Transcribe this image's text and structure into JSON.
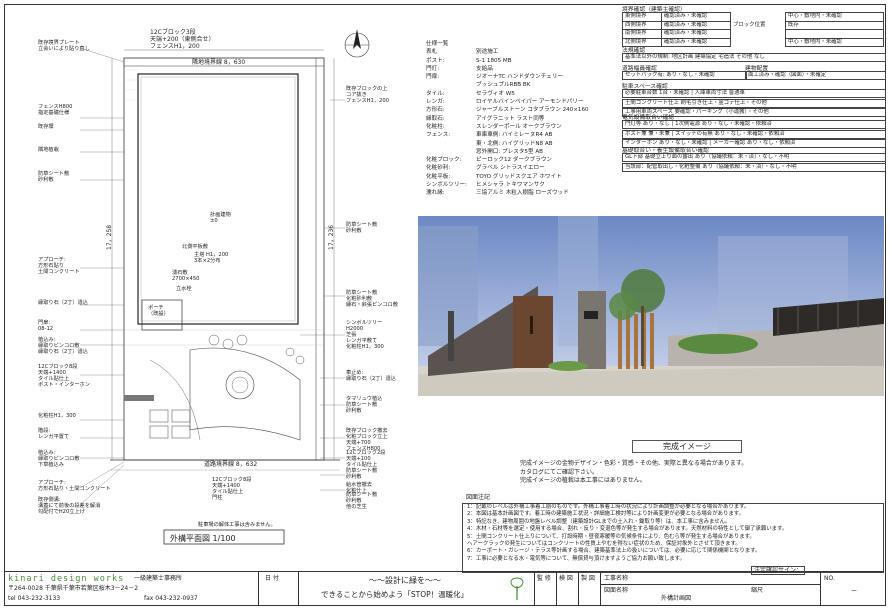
{
  "plan": {
    "top_label": "12Cブロック3段\n天端+200（東側合せ）\nフェンスH1，200",
    "left_labels": [
      "既存境界プレート\n立会いにより貼り直し",
      "フェンスH800\n指定基礎仕様",
      "既存塀",
      "隣地植栽",
      "防草シート敷\n砂利敷",
      "アプローチ:\n方形石貼り\n土間コンクリート",
      "縁取り石（2丁）違込",
      "門扉:\n08-12",
      "植込み:\n縁取りピンコロ敷\n縁取り石（2丁）違込",
      "12Cブロック8段\n天端+1400\nタイル貼仕上\nポスト・インターホン",
      "化粧柱H1，300",
      "階段:\nレンガ平置て",
      "植込み:\n縁取りピンコロ敷\n下草植込み",
      "アプローチ:\n方形石貼り・土間コンクリート",
      "既存側溝:\n溝蓋にて前後の段差を解消\n勾配付でH20立上げ"
    ],
    "right_labels": [
      "既存ブロックの上\nコア抜き\nフェンスH1，200",
      "防草シート敷\n砂利敷",
      "防草シート敷\n化粧砂利敷\n縁石・斜張ピンコロ敷",
      "シンボルツリー\nH2000\n芝張\nレンガ平敷て\n化粧柱H1，300",
      "車止め:\n縁取り石（2丁）違込",
      "タマリュウ植込\n防草シート敷\n砂利敷",
      "既存ブロック撤去\n化粧ブロック立上\n天端+700\nフェンスH800",
      "12Cブロック2段\n天端+100\nタイル貼仕上",
      "防草シート敷\n砂利敷",
      "給水管撤去\n化粧仕上",
      "防草シート敷\n砂利敷\n他の芝生"
    ],
    "center_labels": [
      "計画建物\n±0",
      "北側平板敷",
      "主塔 H1，200\n3本×2分布",
      "湧石敷\n2700×450",
      "立水栓",
      "ポーチ\n（既設）",
      "12Cブロック8段\n天端+1400\nタイル貼仕上\n門柱",
      "駐車場の解体工事は含みません。"
    ],
    "boundary_top": "隣地境界線 8，630",
    "boundary_bottom": "道路境界線 8，632",
    "dim_left": "17，258",
    "dim_right": "17，236",
    "title": "外構平面図 1/100"
  },
  "spec": {
    "header_left": "仕様一覧",
    "header_right": "",
    "rows": [
      {
        "k": "表札",
        "v": "別途施工"
      },
      {
        "k": "ポスト:",
        "v": "S-1 1805 MB"
      },
      {
        "k": "門灯:",
        "v": "支給品"
      },
      {
        "k": "門扉:",
        "v": "ジオーナTC ハンドダウンチェリー"
      },
      {
        "k": "",
        "v": "プッシュプルRBB BK"
      },
      {
        "k": "タイル:",
        "v": "セラヴィオ W5"
      },
      {
        "k": "レンガ:",
        "v": "ロイヤルバインペイパー アーモンドパリー"
      },
      {
        "k": "方形石:",
        "v": "ジャーブルストーン コタブラウン 240×160"
      },
      {
        "k": "縁取石:",
        "v": "アイグラニット ラスト同等"
      },
      {
        "k": "化粧柱:",
        "v": "スレンダーポール オークブラウン"
      },
      {
        "k": "フェンス:",
        "v": "車庫車側: ハイミレーヌR4 AB"
      },
      {
        "k": "",
        "v": "東・北側: ハイグリッドN8 AB"
      },
      {
        "k": "",
        "v": "窓外開口: プレスタ5型 AB"
      },
      {
        "k": "化粧ブロック:",
        "v": "ピーロック12 ダークブラウン"
      },
      {
        "k": "化粧砂利:",
        "v": "グラベル シトラスイエロー"
      },
      {
        "k": "化粧平板:",
        "v": "TOYO グリッドスクエア ホワイト"
      },
      {
        "k": "シンボルツリー:",
        "v": "ヒメシャラ トキワマンサク"
      },
      {
        "k": "濡れ縁:",
        "v": "三協アルミ 木粒入樹脂 ローズウッド"
      }
    ]
  },
  "checks": {
    "boundary_title": "境界確認（建築主確認）",
    "boundary_rows": [
      {
        "side": "東側境界",
        "opt": "確認済み・未確認"
      },
      {
        "side": "西側境界",
        "opt": "確認済み・未確認"
      },
      {
        "side": "南側境界",
        "opt": "確認済み・未確認"
      },
      {
        "side": "北側境界",
        "opt": "確認済み・未確認"
      }
    ],
    "block_label": "ブロック位置",
    "block_opts": [
      "中心・敷地内・未確認",
      "既存",
      "",
      "中心・敷地内・未確認"
    ],
    "law_title": "法規確認",
    "law_row": "基準法以外の規制: 地区計画 建築協定 宅造法 その他 なし",
    "road_title": "道路幅員確認",
    "road_label": "建物配置",
    "road_row1": "セットバック有: あり・なし・未確認",
    "road_row2": "面工済み・確認（図面）・未確定",
    "parking_title": "駐車スペース確認",
    "parking_rows": [
      "必要駐車台数 1台・未確認 | 入庫車両寸法 普通車",
      "土間コンクリート仕上 刷毛引き仕上・金ゴテ仕上・その他",
      "工事用車両スペース 要確認・パーキング（小運搬）・その他"
    ],
    "elec_title": "電気設備取合い確認",
    "elec_rows": [
      "門灯等 あり・なし | 1次側電源 あり・なし・未確認・依頼済",
      "ポスト兼 兼・未兼 | スイッチの有無 あり・なし・未確認・依頼済",
      "インターホン あり・なし・未確認 | メーカー確認 あり・なし・依頼済"
    ],
    "found_title": "基礎取合い・養生設備取合い確認",
    "found_rows": [
      "GL下部 基礎立上り面の露出 あり（協議依頼：未・済）・なし・不明",
      "当該部：配管取出し・化粧整備 あり（協議依頼：未・済）・なし・不明"
    ]
  },
  "render_caption": "完成イメージ",
  "disclaimer": [
    "完成イメージの金物デザイン・色彩・質感・その他、実際と異なる場合があります。",
    "カタログにてご確認下さい。",
    "完成イメージの植栽は本工事にはありません。"
  ],
  "notes_title": "図面注記",
  "notes": [
    "1：記載のレベルは外構工事着工前のものです。外構工事着工時の状況により計画調整が必要となる場合があります。",
    "2：本図は基本計画図です。着工時の建築施工状況・詳細施工検討等により計画変更が必要となる場合があります。",
    "3：特記なき、建物周囲の地盤レベル調整（建築設計GLまでの土入れ・鋤取り等）は、本工事に含みません。",
    "4：木材・石材等を選定・使用する場合、割れ・反り・変退色等が発生する場合があります。天然材料の特性として御了承願います。",
    "5：土間コンクリート仕上りについて、打設時期・昼夜寒暖等の気候条件により、色むら等が発生する場合があります。",
    "ヘアークラックの発生についてはコンクリートの性質上やむを得ない症状のため、保証対象外とさせて頂きます。",
    "6：カーポート・ガレージ・テラス等計画する場合、建築基準法上の扱いについては、必要に応じて関係機関となります。",
    "7：工事に必要となる水・電気等について、無償貸与頂けますようご協力お願い致します。"
  ],
  "footer": {
    "company": "kinari design works",
    "company_sub": "一級建築士事務所",
    "address": "〒264-0028 千葉県千葉市若葉区桜木3－24－2",
    "tel": "tel 043-232-3133",
    "fax": "fax 043-232-0937",
    "date_label": "日 付",
    "slogan1": "〜〜設計に緑を〜〜",
    "slogan2": "できることから始めよう「STOP！温暖化」",
    "approve": "監 修",
    "check": "検 図",
    "draw": "製 図",
    "project_label": "工事名称",
    "sheet_label": "図面名称",
    "sheet_name": "外構計画図",
    "scale_label": "縮尺",
    "sign_label": "法定確認サイン：",
    "no_label": "NO.",
    "no_value": "ー"
  }
}
